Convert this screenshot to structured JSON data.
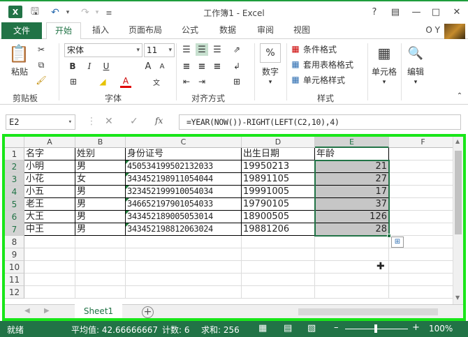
{
  "window": {
    "title": "工作簿1 - Excel",
    "help_label": "?",
    "user": "O Y",
    "quick_access": [
      "save-icon",
      "undo-icon",
      "redo-icon",
      "customize-icon"
    ]
  },
  "tabs": [
    "文件",
    "开始",
    "插入",
    "页面布局",
    "公式",
    "数据",
    "审阅",
    "视图"
  ],
  "ribbon": {
    "clipboard": {
      "paste": "粘贴",
      "label": "剪贴板"
    },
    "font": {
      "name": "宋体",
      "size": "11",
      "label": "字体",
      "bold": "B",
      "italic": "I",
      "underline": "U",
      "grow": "A",
      "shrink": "A",
      "font_color": "A"
    },
    "alignment": {
      "label": "对齐方式"
    },
    "number": {
      "button": "数字",
      "symbol": "%"
    },
    "styles": {
      "conditional": "条件格式",
      "table": "套用表格格式",
      "cell": "单元格样式",
      "label": "样式"
    },
    "cells": {
      "button": "单元格"
    },
    "editing": {
      "button": "编辑"
    }
  },
  "formula_bar": {
    "name_box": "E2",
    "formula": "=YEAR(NOW())-RIGHT(LEFT(C2,10),4)",
    "fx": "fx"
  },
  "grid": {
    "columns": [
      "A",
      "B",
      "C",
      "D",
      "E",
      "F"
    ],
    "row_numbers": [
      "1",
      "2",
      "3",
      "4",
      "5",
      "6",
      "7",
      "8",
      "9",
      "10",
      "11",
      "12"
    ],
    "headers": [
      "名字",
      "姓别",
      "身份证号",
      "出生日期",
      "年龄"
    ],
    "rows": [
      [
        "小明",
        "男",
        "450534199502132033",
        "19950213",
        "21"
      ],
      [
        "小花",
        "女",
        "343452198911054044",
        "19891105",
        "27"
      ],
      [
        "小五",
        "男",
        "323452199910054034",
        "19991005",
        "17"
      ],
      [
        "老王",
        "男",
        "346652197901054033",
        "19790105",
        "37"
      ],
      [
        "大王",
        "男",
        "343452189005053014",
        "18900505",
        "126"
      ],
      [
        "中王",
        "男",
        "343452198812063024",
        "19881206",
        "28"
      ]
    ]
  },
  "sheets": [
    "Sheet1"
  ],
  "status": {
    "ready": "就绪",
    "average": "平均值: 42.66666667",
    "count": "计数: 6",
    "sum": "求和: 256",
    "zoom": "100%"
  },
  "colors": {
    "excel_green": "#217346",
    "highlight_frame": "#19e619"
  }
}
